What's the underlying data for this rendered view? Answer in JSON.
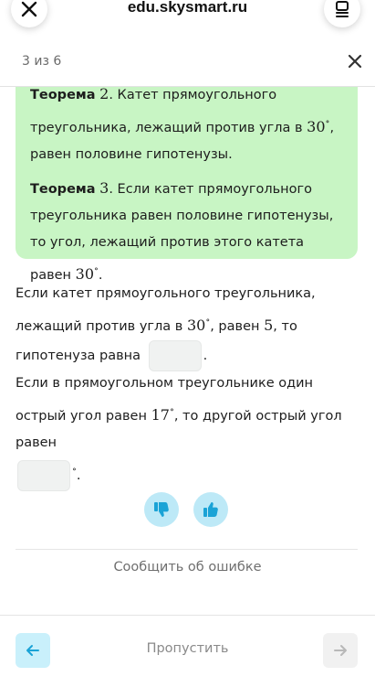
{
  "browser": {
    "url": "edu.skysmart.ru"
  },
  "progress": {
    "text": "3 из 6"
  },
  "theory": {
    "t2": {
      "label": "Теорема",
      "number": "2",
      "text1": ". Катет прямоугольного треугольника, лежащий против угла в ",
      "angle": "30",
      "degree": "∘",
      "text2": ", равен половине гипотенузы."
    },
    "t3": {
      "label": "Теорема",
      "number": "3",
      "text1": ". Если катет прямоугольного треугольника равен половине гипотенузы, то угол, лежащий против этого катета равен ",
      "angle": "30",
      "degree": "∘",
      "text2": "."
    }
  },
  "task1": {
    "text1": "Если катет прямоугольного треугольника, лежащий против угла в ",
    "angle": "30",
    "degree": "∘",
    "text2": ", равен ",
    "value": "5",
    "text3": ", то гипотенуза равна ",
    "answer": "",
    "end": "."
  },
  "task2": {
    "text1": "Если в прямоугольном треугольнике один острый угол равен ",
    "angle": "17",
    "degree": "∘",
    "text2": ", то другой острый угол равен ",
    "answer": "",
    "end_degree": "∘",
    "end": "."
  },
  "feedback": {
    "report": "Сообщить об ошибке"
  },
  "footer": {
    "skip": "Пропустить"
  },
  "colors": {
    "card_bg": "#c8f5c4",
    "accent_blue": "#bde9f7",
    "icon_blue": "#1aa3d6"
  }
}
